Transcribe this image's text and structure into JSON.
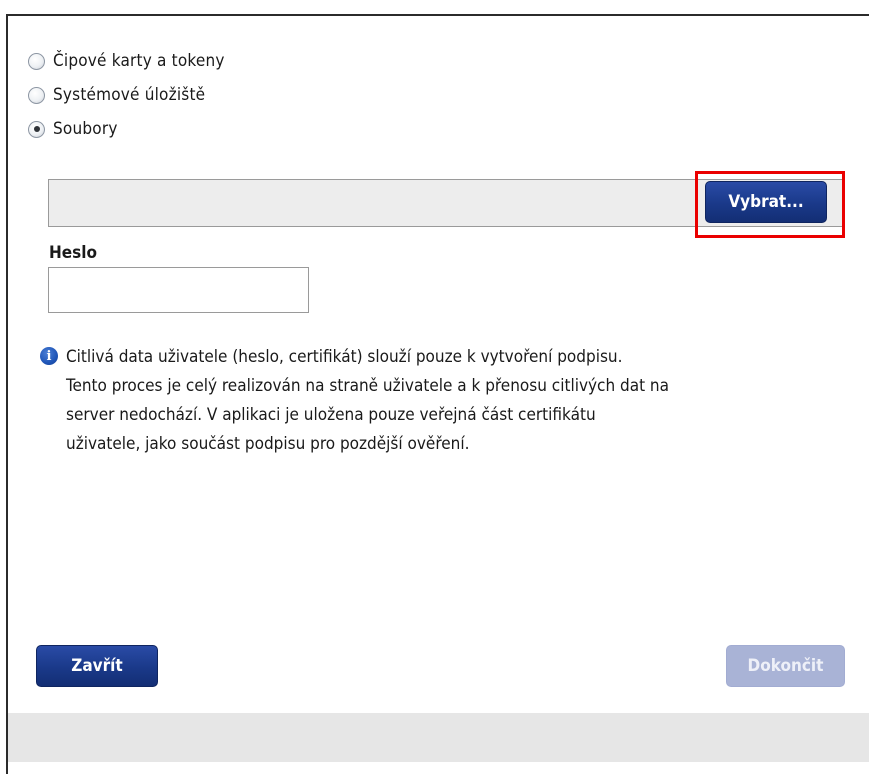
{
  "signing_source": {
    "options": [
      {
        "label": "Čipové karty a tokeny",
        "selected": false
      },
      {
        "label": "Systémové úložiště",
        "selected": false
      },
      {
        "label": "Soubory",
        "selected": true
      }
    ]
  },
  "file_picker": {
    "value": "",
    "browse_label": "Vybrat..."
  },
  "password": {
    "label": "Heslo",
    "value": ""
  },
  "info": {
    "icon": "info-icon",
    "lines": [
      "Citlivá data uživatele (heslo, certifikát) slouží pouze k vytvoření podpisu.",
      "Tento proces je celý realizován na straně uživatele a k přenosu citlivých dat na",
      "server nedochází. V aplikaci je uložena pouze veřejná část certifikátu",
      "uživatele, jako součást podpisu pro pozdější ověření."
    ]
  },
  "footer": {
    "close_label": "Zavřít",
    "finish_label": "Dokončit"
  },
  "colors": {
    "primary_button": "#1a3989",
    "disabled_button": "#a9b3d6",
    "highlight": "#ea0000",
    "footer_bar": "#e6e6e6"
  }
}
